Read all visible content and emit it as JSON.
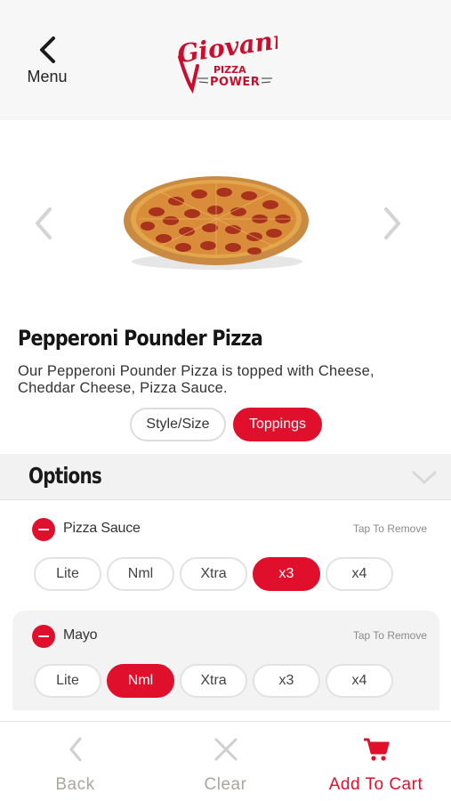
{
  "header": {
    "menu_label": "Menu",
    "logo": {
      "text": "Giovanni's",
      "tagline": "PIZZA POWER"
    }
  },
  "colors": {
    "accent": "#e0102d",
    "muted": "#a9a89a",
    "header_bg": "#f7f7f7"
  },
  "product": {
    "title": "Pepperoni Pounder Pizza",
    "description": "Our Pepperoni Pounder Pizza is topped with Cheese, Cheddar Cheese, Pizza Sauce."
  },
  "tabs": [
    {
      "label": "Style/Size",
      "active": false
    },
    {
      "label": "Toppings",
      "active": true
    }
  ],
  "options": {
    "title": "Options",
    "toppings": [
      {
        "name": "Pizza Sauce",
        "action": "Tap To Remove",
        "amounts": [
          "Lite",
          "Nml",
          "Xtra",
          "x3",
          "x4"
        ],
        "selected": "x3"
      },
      {
        "name": "Mayo",
        "action": "Tap To Remove",
        "amounts": [
          "Lite",
          "Nml",
          "Xtra",
          "x3",
          "x4"
        ],
        "selected": "Nml"
      }
    ]
  },
  "bottom_bar": {
    "back": {
      "label": "Back",
      "icon": "chevron-left-icon"
    },
    "clear": {
      "label": "Clear",
      "icon": "close-icon"
    },
    "cart": {
      "label": "Add To Cart",
      "icon": "cart-icon"
    }
  }
}
